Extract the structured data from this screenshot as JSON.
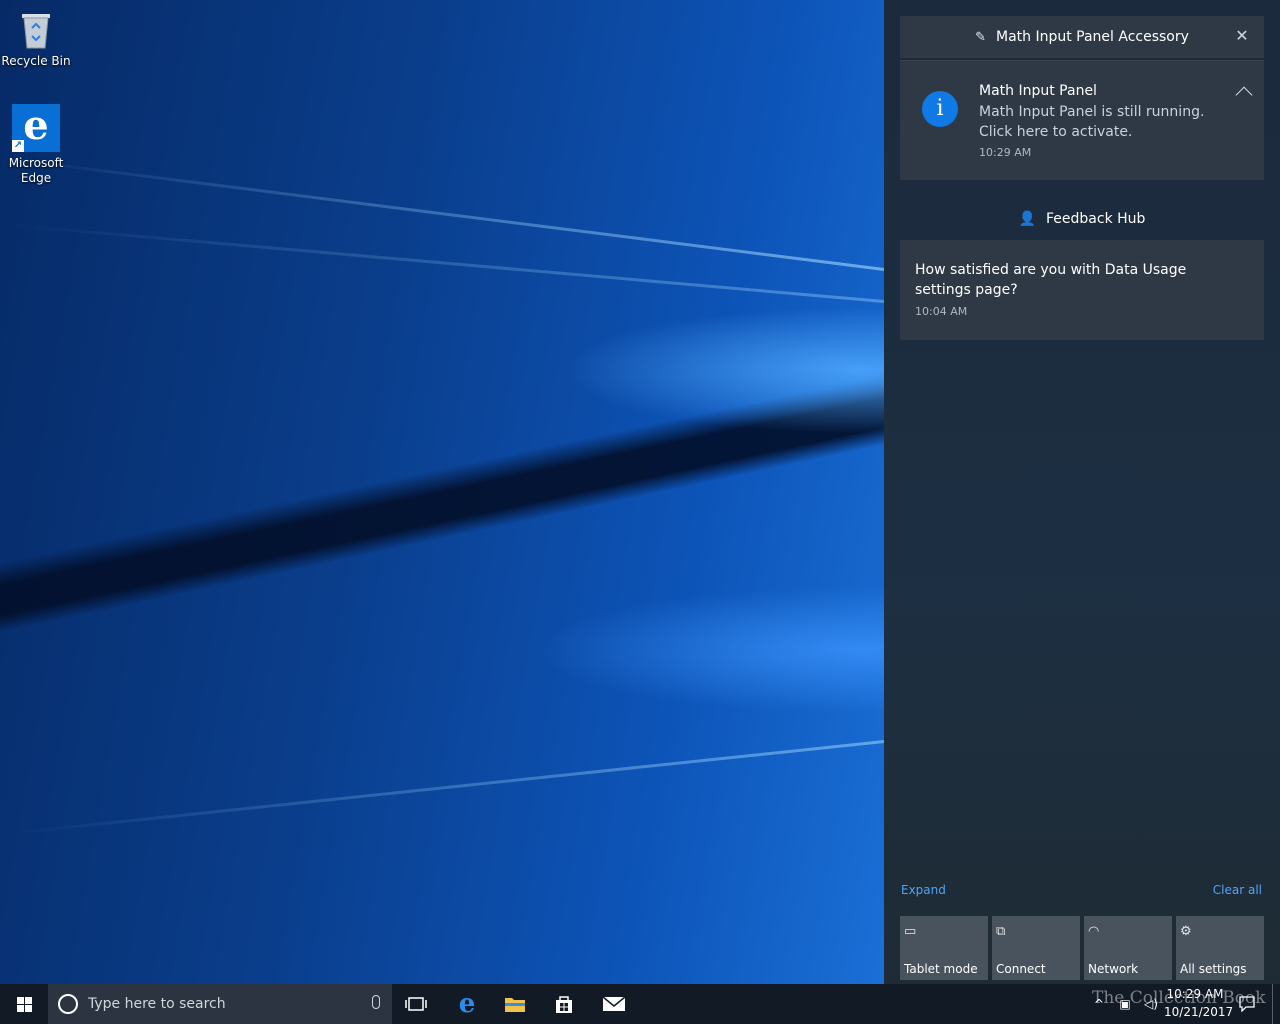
{
  "desktop": {
    "icons": [
      {
        "label": "Recycle Bin",
        "icon": "recycle-bin-icon"
      },
      {
        "label": "Microsoft\nEdge",
        "icon": "edge-icon"
      }
    ]
  },
  "action_center": {
    "groups": [
      {
        "app": "Math Input Panel Accessory",
        "icon": "math-input-panel-icon",
        "notification": {
          "title": "Math Input Panel",
          "body_line1": "Math Input Panel is still running.",
          "body_line2": "Click here to activate.",
          "time": "10:29 AM",
          "icon": "info-icon"
        }
      },
      {
        "app": "Feedback Hub",
        "icon": "feedback-hub-icon",
        "notification": {
          "title_line1": "How satisfied are you with Data Usage",
          "title_line2": "settings page?",
          "time": "10:04 AM"
        }
      }
    ],
    "expand_label": "Expand",
    "clear_all_label": "Clear all",
    "quick_actions": [
      {
        "label": "Tablet mode",
        "icon": "tablet-mode-icon"
      },
      {
        "label": "Connect",
        "icon": "connect-icon"
      },
      {
        "label": "Network",
        "icon": "network-icon"
      },
      {
        "label": "All settings",
        "icon": "settings-gear-icon"
      }
    ],
    "accent_color": "#0f7ae5",
    "link_color": "#4fa3f7"
  },
  "taskbar": {
    "search_placeholder": "Type here to search",
    "pinned": [
      "task-view-icon",
      "edge-icon",
      "file-explorer-icon",
      "store-icon",
      "mail-icon"
    ],
    "clock_time": "10:29 AM",
    "clock_date": "10/21/2017"
  },
  "watermark": "The Collection Book"
}
